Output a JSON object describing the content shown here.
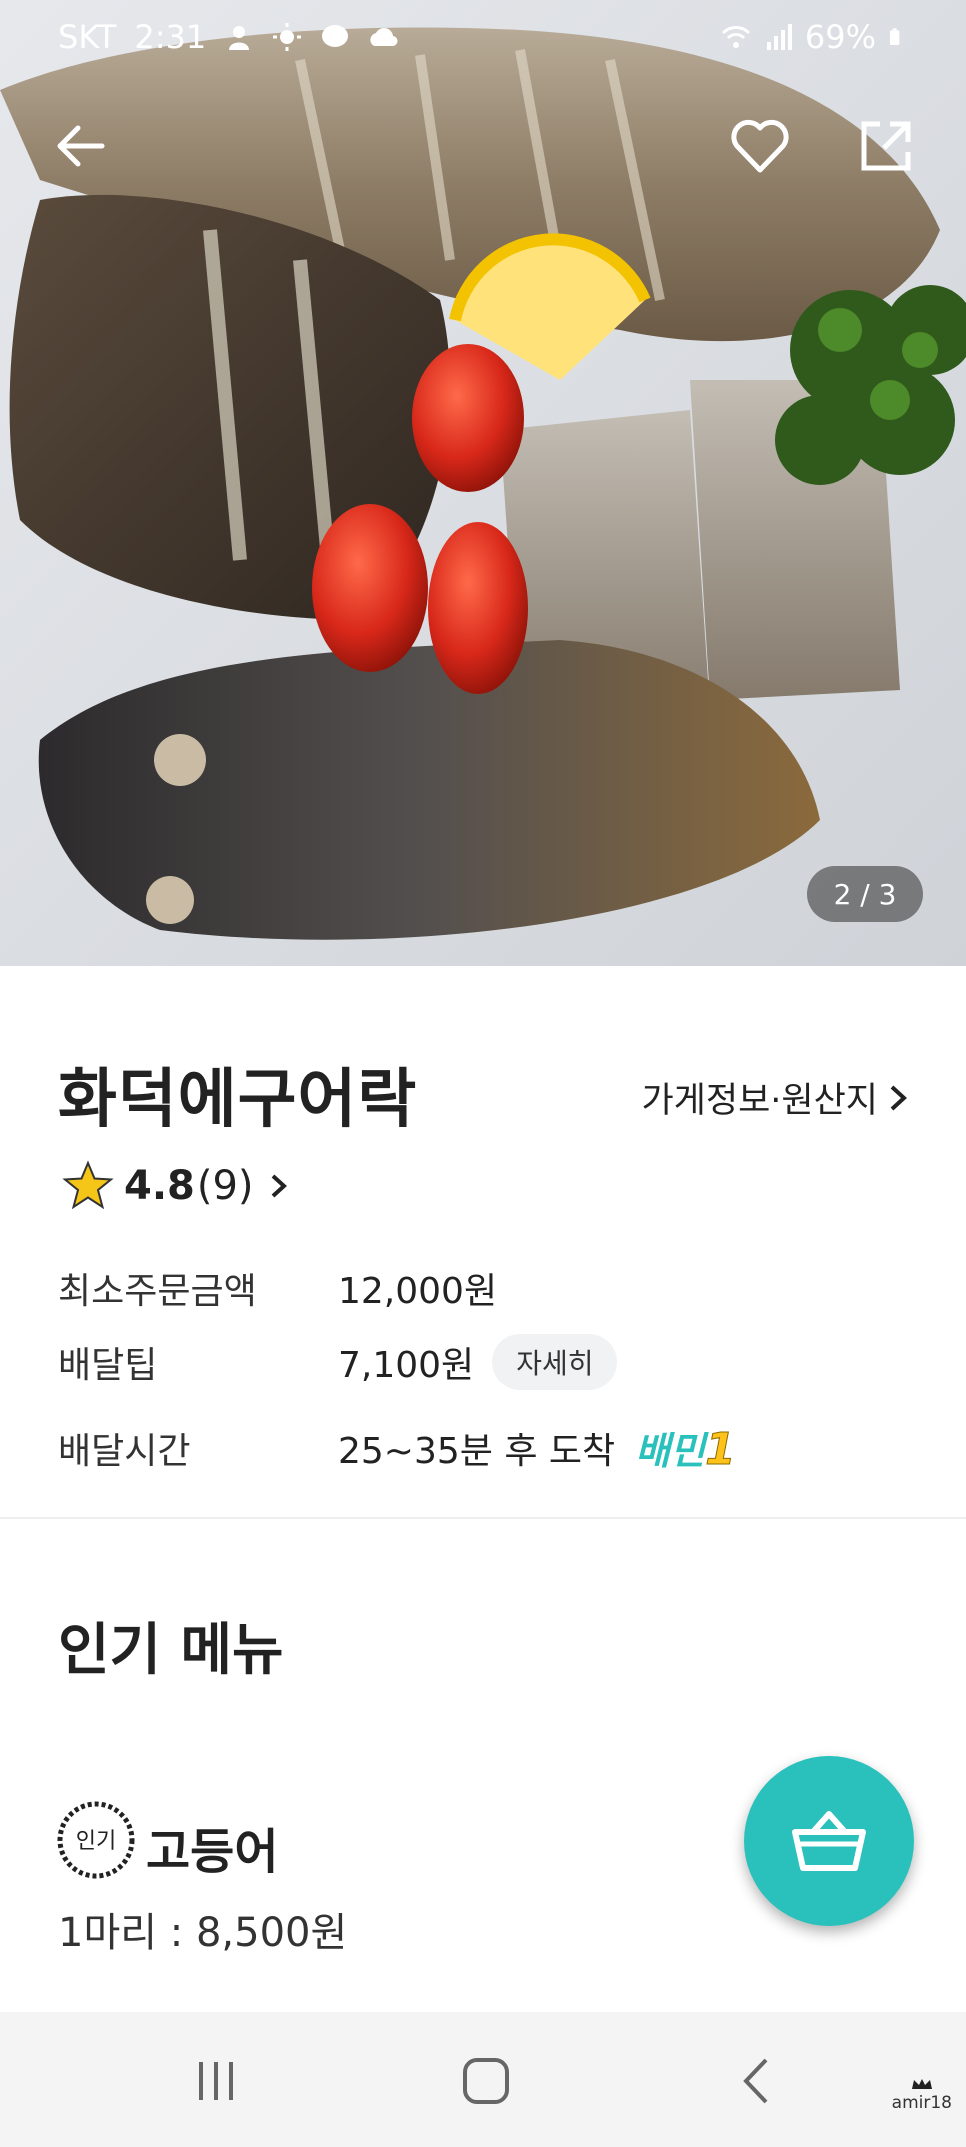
{
  "status_bar": {
    "carrier": "SKT",
    "time": "2:31",
    "battery": "69%"
  },
  "hero": {
    "image_counter": "2 / 3",
    "icons": [
      "back-arrow-icon",
      "heart-icon",
      "share-icon"
    ]
  },
  "store": {
    "name": "화덕에구어락",
    "info_link": "가게정보·원산지",
    "rating": "4.8",
    "review_count": "(9)",
    "min_order_label": "최소주문금액",
    "min_order_value": "12,000원",
    "delivery_tip_label": "배달팁",
    "delivery_tip_value": "7,100원",
    "detail_button": "자세히",
    "delivery_time_label": "배달시간",
    "delivery_time_value": "25~35분 후 도착",
    "baemin_badge_text": "배민",
    "baemin_badge_num": "1"
  },
  "popular_menu": {
    "title": "인기 메뉴",
    "badge_text": "인기",
    "items": [
      {
        "name": "고등어",
        "price": "1마리 : 8,500원"
      }
    ]
  },
  "watermark": "amir18",
  "colors": {
    "accent": "#2ac1bc",
    "star": "#f5c518"
  }
}
